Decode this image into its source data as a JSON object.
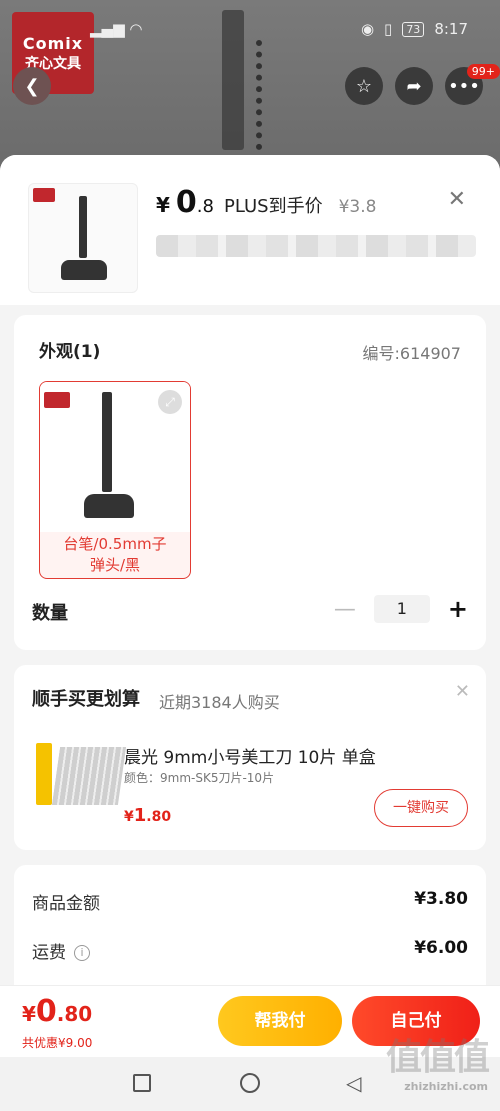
{
  "status_bar": {
    "time": "8:17",
    "battery": "73"
  },
  "background": {
    "brand_line1": "Comix",
    "brand_line2": "齐心文具",
    "cart_badge": "99+"
  },
  "header": {
    "price_yen": "¥",
    "price_int": "0",
    "price_dec": ".8",
    "price_type": "PLUS到手价",
    "original_price": "¥3.8"
  },
  "appearance": {
    "title": "外观(1)",
    "sku_number": "编号:614907",
    "variants": [
      {
        "label_line1": "台笔/0.5mm子",
        "label_line2": "弹头/黑",
        "selected": true
      }
    ]
  },
  "quantity": {
    "label": "数量",
    "value": "1"
  },
  "bundle": {
    "title": "顺手买更划算",
    "subtitle": "近期3184人购买",
    "item": {
      "name": "晨光 9mm小号美工刀 10片 单盒",
      "color": "颜色：9mm-SK5刀片-10片",
      "price_yen": "¥",
      "price_int": "1",
      "price_dec": ".80",
      "buy_label": "一键购买"
    }
  },
  "totals": {
    "goods_label": "商品金额",
    "goods_value": "¥3.80",
    "shipping_label": "运费",
    "shipping_value": "¥6.00"
  },
  "pay_bar": {
    "price_yen": "¥",
    "price_int": "0",
    "price_dec": ".80",
    "savings": "共优惠¥9.00",
    "help_pay_label": "帮我付",
    "self_pay_label": "自己付"
  },
  "watermark": {
    "main": "值值值",
    "sub": "zhizhizhi.com"
  },
  "colors": {
    "accent_red": "#e2231a",
    "help_yellow": "#ffb000"
  }
}
